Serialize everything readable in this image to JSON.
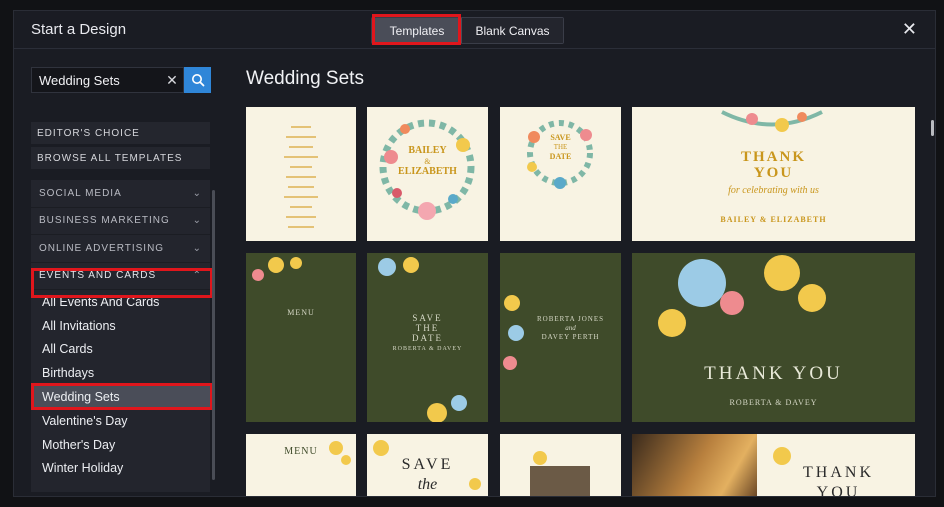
{
  "header": {
    "title": "Start a Design",
    "tabs": [
      {
        "label": "Templates",
        "active": true
      },
      {
        "label": "Blank Canvas",
        "active": false
      }
    ],
    "close_icon": "close-icon"
  },
  "sidebar": {
    "search": {
      "value": "Wedding Sets",
      "placeholder": "Search"
    },
    "buttons": [
      "EDITOR'S CHOICE",
      "BROWSE ALL TEMPLATES"
    ],
    "categories": [
      {
        "label": "SOCIAL MEDIA",
        "expanded": false
      },
      {
        "label": "BUSINESS MARKETING",
        "expanded": false
      },
      {
        "label": "ONLINE ADVERTISING",
        "expanded": false
      },
      {
        "label": "EVENTS AND CARDS",
        "expanded": true
      }
    ],
    "subitems": [
      {
        "label": "All Events And Cards"
      },
      {
        "label": "All Invitations"
      },
      {
        "label": "All Cards"
      },
      {
        "label": "Birthdays"
      },
      {
        "label": "Wedding Sets",
        "active": true
      },
      {
        "label": "Valentine's Day"
      },
      {
        "label": "Mother's Day"
      },
      {
        "label": "Winter Holiday"
      }
    ]
  },
  "main": {
    "title": "Wedding Sets",
    "cards": [
      {
        "style": "cream"
      },
      {
        "style": "cream",
        "text": [
          "BAILEY",
          "&",
          "ELIZABETH"
        ]
      },
      {
        "style": "cream",
        "text": [
          "SAVE",
          "THE",
          "DATE"
        ]
      },
      {
        "style": "cream",
        "text": [
          "THANK",
          "YOU",
          "for celebrating with us",
          "BAILEY & ELIZABETH"
        ]
      },
      {
        "style": "green",
        "text": [
          "MENU"
        ]
      },
      {
        "style": "green",
        "text": [
          "SAVE",
          "THE",
          "DATE",
          "ROBERTA & DAVEY"
        ]
      },
      {
        "style": "green",
        "text": [
          "ROBERTA JONES",
          "and",
          "DAVEY PERTH"
        ]
      },
      {
        "style": "green",
        "text": [
          "THANK YOU",
          "ROBERTA & DAVEY"
        ]
      },
      {
        "style": "cream",
        "text": [
          "MENU"
        ]
      },
      {
        "style": "cream",
        "text": [
          "SAVE",
          "the"
        ]
      },
      {
        "style": "cream"
      },
      {
        "style": "cream",
        "text": [
          "THANK",
          "YOU"
        ]
      }
    ]
  },
  "colors": {
    "accent": "#2f86d8",
    "highlight": "#e0161c",
    "cream": "#f8f3e3",
    "green": "#3f4b2a",
    "gold": "#c9961c"
  }
}
